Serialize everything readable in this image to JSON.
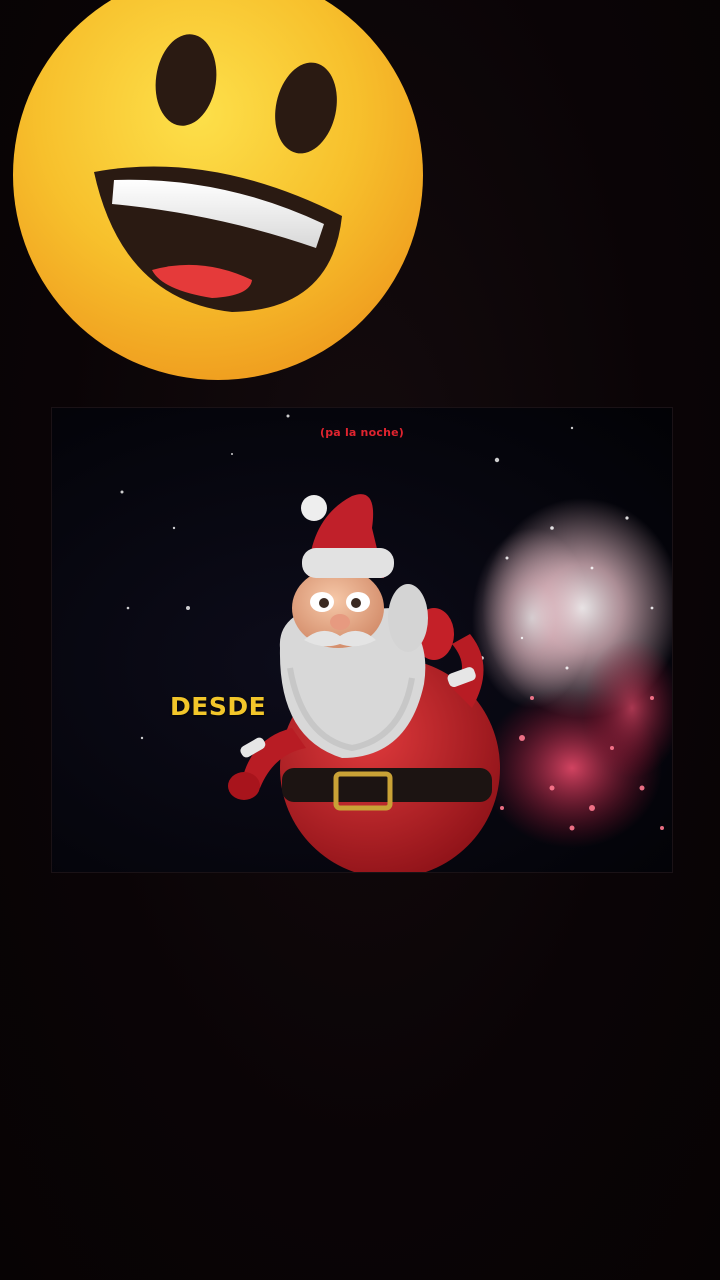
{
  "stickers": {
    "emoji": {
      "icon": "grinning-face-icon",
      "color": "#f7c02c"
    }
  },
  "video": {
    "top_caption": "(pa la noche)",
    "main_caption": "DESDE",
    "colors": {
      "top_caption": "#e0242f",
      "main_caption": "#f2c62a",
      "santa_suit": "#c0202a"
    }
  }
}
